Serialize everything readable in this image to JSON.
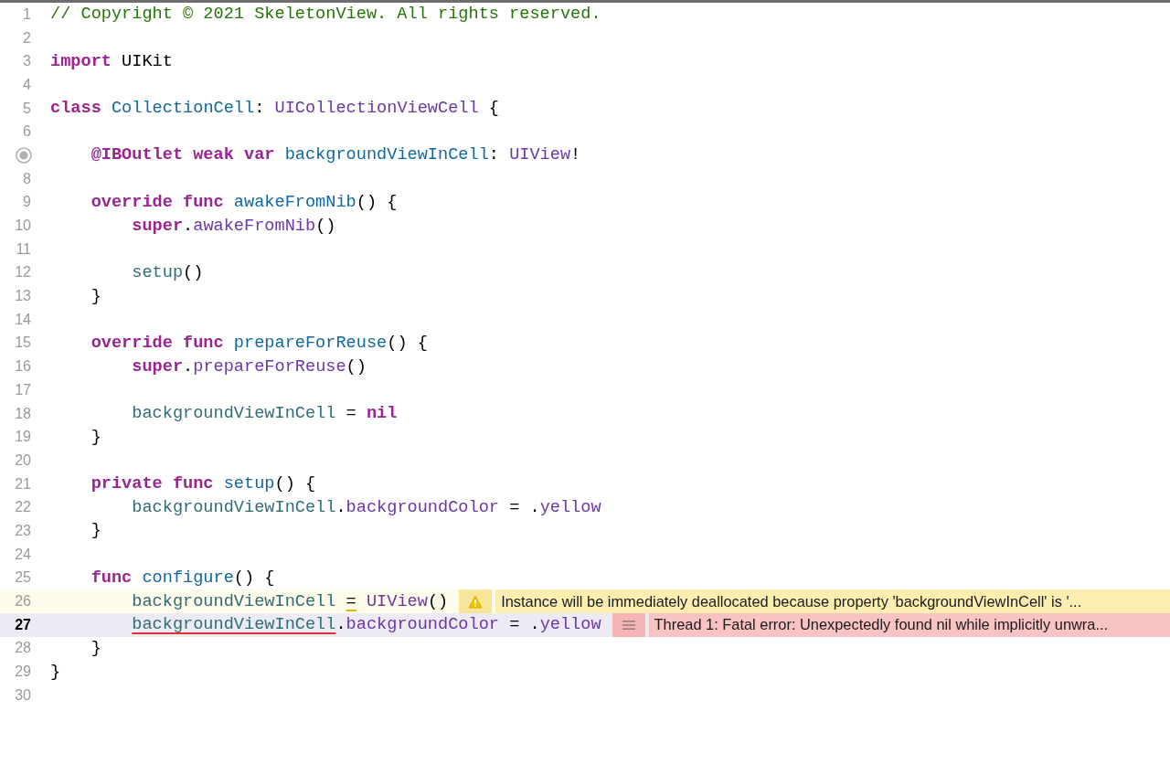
{
  "editor": {
    "lines": [
      {
        "number": "1",
        "current": false,
        "tokens": [
          {
            "kind": "comment",
            "text": "// Copyright © 2021 SkeletonView. All rights reserved."
          }
        ]
      },
      {
        "number": "2",
        "current": false
      },
      {
        "number": "3",
        "current": false,
        "tokens": [
          {
            "kind": "keyword",
            "text": "import"
          },
          {
            "kind": "plain",
            "text": " UIKit"
          }
        ]
      },
      {
        "number": "4",
        "current": false
      },
      {
        "number": "5",
        "current": false,
        "tokens": [
          {
            "kind": "keyword",
            "text": "class"
          },
          {
            "kind": "decl",
            "text": " CollectionCell"
          },
          {
            "kind": "plain",
            "text": ": "
          },
          {
            "kind": "system",
            "text": "UICollectionViewCell"
          },
          {
            "kind": "plain",
            "text": " {"
          }
        ]
      },
      {
        "number": "6",
        "current": false
      },
      {
        "current": false,
        "outlet": true,
        "tokens": [
          {
            "kind": "keyword",
            "text": "    @IBOutlet weak var"
          },
          {
            "kind": "decl",
            "text": " backgroundViewInCell"
          },
          {
            "kind": "plain",
            "text": ": "
          },
          {
            "kind": "system",
            "text": "UIView"
          },
          {
            "kind": "plain",
            "text": "!"
          }
        ]
      },
      {
        "number": "8",
        "current": false
      },
      {
        "number": "9",
        "current": false,
        "tokens": [
          {
            "kind": "keyword",
            "text": "    override func"
          },
          {
            "kind": "decl",
            "text": " awakeFromNib"
          },
          {
            "kind": "plain",
            "text": "() {"
          }
        ]
      },
      {
        "number": "10",
        "current": false,
        "tokens": [
          {
            "kind": "keyword",
            "text": "        super"
          },
          {
            "kind": "plain",
            "text": "."
          },
          {
            "kind": "system",
            "text": "awakeFromNib"
          },
          {
            "kind": "plain",
            "text": "()"
          }
        ]
      },
      {
        "number": "11",
        "current": false
      },
      {
        "number": "12",
        "current": false,
        "tokens": [
          {
            "kind": "project",
            "text": "        setup"
          },
          {
            "kind": "plain",
            "text": "()"
          }
        ]
      },
      {
        "number": "13",
        "current": false,
        "tokens": [
          {
            "kind": "plain",
            "text": "    }"
          }
        ]
      },
      {
        "number": "14",
        "current": false
      },
      {
        "number": "15",
        "current": false,
        "tokens": [
          {
            "kind": "keyword",
            "text": "    override func"
          },
          {
            "kind": "decl",
            "text": " prepareForReuse"
          },
          {
            "kind": "plain",
            "text": "() {"
          }
        ]
      },
      {
        "number": "16",
        "current": false,
        "tokens": [
          {
            "kind": "keyword",
            "text": "        super"
          },
          {
            "kind": "plain",
            "text": "."
          },
          {
            "kind": "system",
            "text": "prepareForReuse"
          },
          {
            "kind": "plain",
            "text": "()"
          }
        ]
      },
      {
        "number": "17",
        "current": false
      },
      {
        "number": "18",
        "current": false,
        "tokens": [
          {
            "kind": "project",
            "text": "        backgroundViewInCell"
          },
          {
            "kind": "plain",
            "text": " ="
          },
          {
            "kind": "keyword",
            "text": " nil"
          }
        ]
      },
      {
        "number": "19",
        "current": false,
        "tokens": [
          {
            "kind": "plain",
            "text": "    }"
          }
        ]
      },
      {
        "number": "20",
        "current": false
      },
      {
        "number": "21",
        "current": false,
        "tokens": [
          {
            "kind": "keyword",
            "text": "    private func"
          },
          {
            "kind": "decl",
            "text": " setup"
          },
          {
            "kind": "plain",
            "text": "() {"
          }
        ]
      },
      {
        "number": "22",
        "current": false,
        "tokens": [
          {
            "kind": "project",
            "text": "        backgroundViewInCell"
          },
          {
            "kind": "plain",
            "text": "."
          },
          {
            "kind": "system",
            "text": "backgroundColor"
          },
          {
            "kind": "plain",
            "text": " = ."
          },
          {
            "kind": "system",
            "text": "yellow"
          }
        ]
      },
      {
        "number": "23",
        "current": false,
        "tokens": [
          {
            "kind": "plain",
            "text": "    }"
          }
        ]
      },
      {
        "number": "24",
        "current": false
      },
      {
        "number": "25",
        "current": false,
        "tokens": [
          {
            "kind": "keyword",
            "text": "    func"
          },
          {
            "kind": "decl",
            "text": " configure"
          },
          {
            "kind": "plain",
            "text": "() {"
          }
        ]
      },
      {
        "number": "26",
        "current": false,
        "annotation": {
          "kind": "warning",
          "text": "Instance will be immediately deallocated because property 'backgroundViewInCell' is '..."
        },
        "tokens": [
          {
            "kind": "project",
            "text": "        backgroundViewInCell "
          },
          {
            "kind": "plain",
            "underlined": true,
            "text": "="
          },
          {
            "kind": "system",
            "text": " UIView"
          },
          {
            "kind": "plain",
            "text": "()"
          }
        ]
      },
      {
        "number": "27",
        "current": true,
        "annotation": {
          "kind": "error",
          "text": "Thread 1: Fatal error: Unexpectedly found nil while implicitly unwra..."
        },
        "tokens": [
          {
            "kind": "project",
            "underlined": true,
            "text": "        backgroundViewInCell"
          },
          {
            "kind": "plain",
            "text": "."
          },
          {
            "kind": "system",
            "text": "backgroundColor"
          },
          {
            "kind": "plain",
            "text": " = ."
          },
          {
            "kind": "system",
            "text": "yellow"
          }
        ]
      },
      {
        "number": "28",
        "current": false,
        "tokens": [
          {
            "kind": "plain",
            "text": "    }"
          }
        ]
      },
      {
        "number": "29",
        "current": false,
        "tokens": [
          {
            "kind": "plain",
            "text": "}"
          }
        ]
      },
      {
        "number": "30",
        "current": false
      }
    ]
  }
}
